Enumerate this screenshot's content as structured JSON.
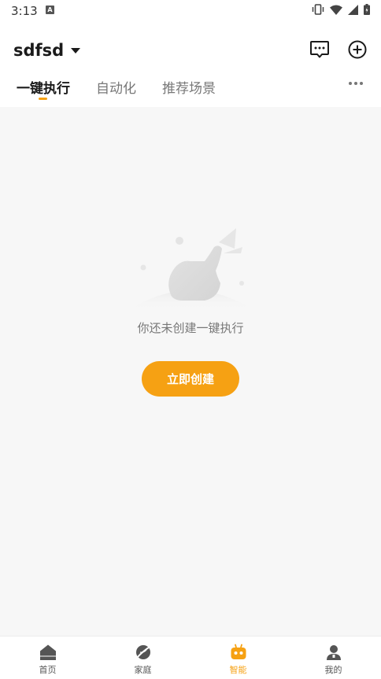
{
  "status": {
    "time": "3:13",
    "notification_icon": "A"
  },
  "header": {
    "home_name": "sdfsd"
  },
  "tabs": [
    {
      "label": "一键执行",
      "active": true
    },
    {
      "label": "自动化",
      "active": false
    },
    {
      "label": "推荐场景",
      "active": false
    }
  ],
  "empty": {
    "message": "你还未创建一键执行",
    "button_label": "立即创建"
  },
  "nav": [
    {
      "label": "首页",
      "icon": "home-icon"
    },
    {
      "label": "家庭",
      "icon": "planet-icon"
    },
    {
      "label": "智能",
      "icon": "robot-icon",
      "active": true
    },
    {
      "label": "我的",
      "icon": "user-icon"
    }
  ],
  "colors": {
    "accent": "#f6a113",
    "background": "#f7f7f7"
  }
}
